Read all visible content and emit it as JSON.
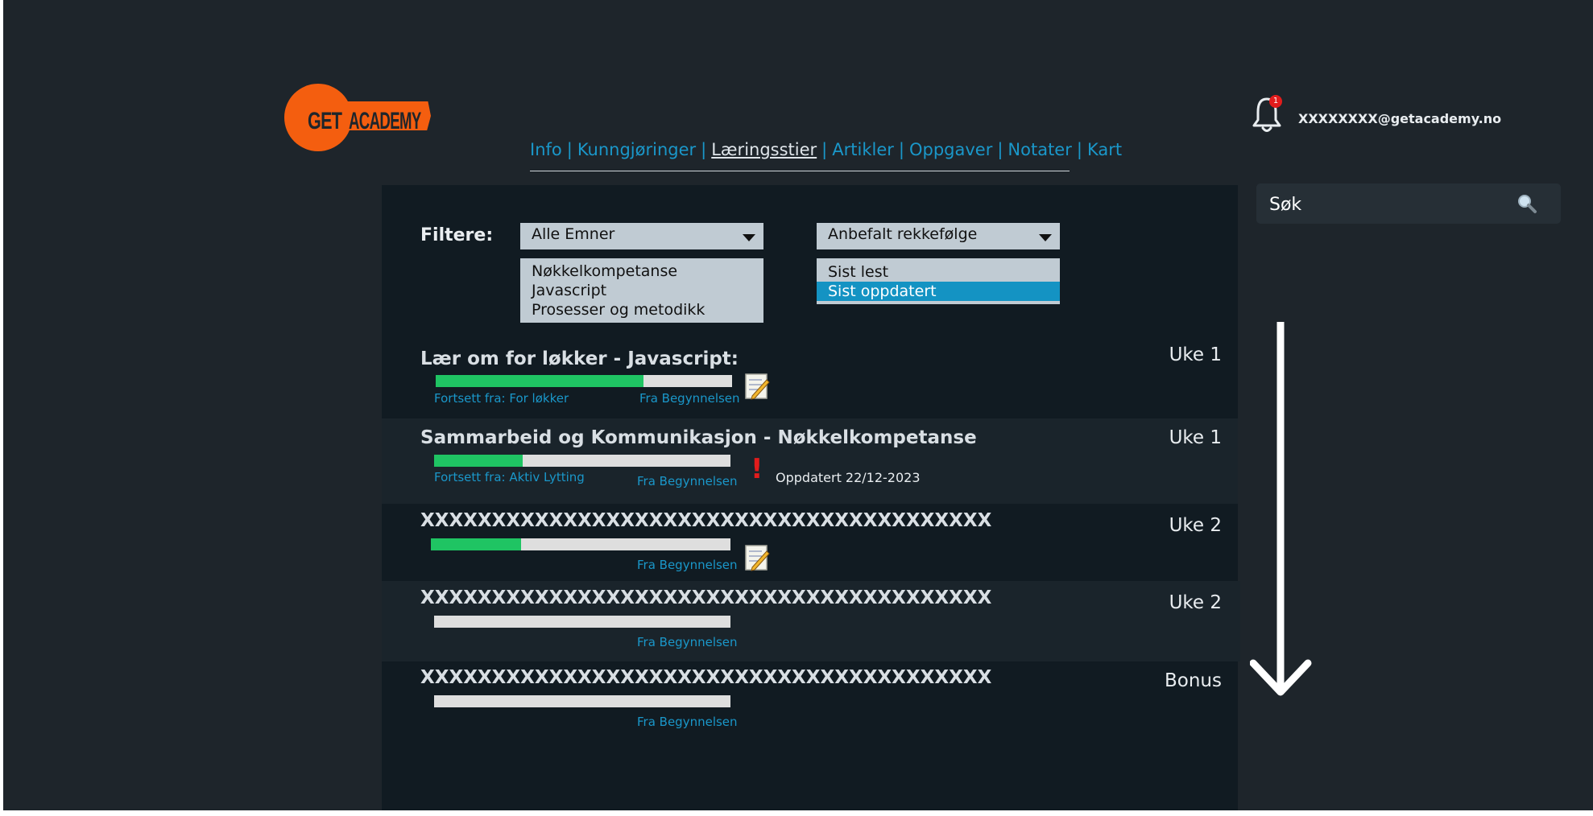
{
  "logo": {
    "text_left": "GET",
    "text_right": "ACADEMY"
  },
  "nav": {
    "items": [
      "Info",
      "Kunngjøringer",
      "Læringsstier",
      "Artikler",
      "Oppgaver",
      "Notater",
      "Kart"
    ],
    "separator": "|",
    "active": "Læringsstier"
  },
  "header": {
    "notification_count": "1",
    "user_email": "XXXXXXXX@getacademy.no"
  },
  "search": {
    "placeholder": "Søk",
    "icon": "magnifier-icon"
  },
  "filters": {
    "label": "Filtere:",
    "topic_select": {
      "value": "Alle Emner",
      "options": [
        "Nøkkelkompetanse",
        "Javascript",
        "Prosesser og metodikk"
      ]
    },
    "order_select": {
      "value": "Anbefalt rekkefølge",
      "options": [
        "Sist lest",
        "Sist oppdatert"
      ],
      "highlighted": "Sist oppdatert"
    }
  },
  "courses": [
    {
      "title": "Lær om for løkker  - Javascript:",
      "week": "Uke 1",
      "progress": 0.7,
      "continue": "Fortsett fra: For løkker",
      "restart": "Fra Begynnelsen",
      "icon": "memo-icon"
    },
    {
      "title": "Sammarbeid og Kommunikasjon  - Nøkkelkompetanse",
      "week": "Uke 1",
      "progress": 0.3,
      "continue": "Fortsett fra: Aktiv Lytting",
      "restart": "Fra Begynnelsen",
      "icon": "exclamation-icon",
      "alert": "!",
      "updated": "Oppdatert 22/12-2023"
    },
    {
      "title": "XXXXXXXXXXXXXXXXXXXXXXXXXXXXXXXXXXXXXXXX",
      "week": "Uke 2",
      "progress": 0.3,
      "restart": "Fra Begynnelsen",
      "icon": "memo-icon"
    },
    {
      "title": "XXXXXXXXXXXXXXXXXXXXXXXXXXXXXXXXXXXXXXXX",
      "week": "Uke 2",
      "progress": 0,
      "restart": "Fra Begynnelsen"
    },
    {
      "title": "XXXXXXXXXXXXXXXXXXXXXXXXXXXXXXXXXXXXXXXX",
      "week": "Bonus",
      "progress": 0,
      "restart": "Fra Begynnelsen"
    }
  ],
  "colors": {
    "background": "#1e252b",
    "panel": "#111b22",
    "accent": "#1a97c9",
    "progress": "#1fc463",
    "brand": "#f45e0f",
    "alert": "#e21c1c"
  }
}
